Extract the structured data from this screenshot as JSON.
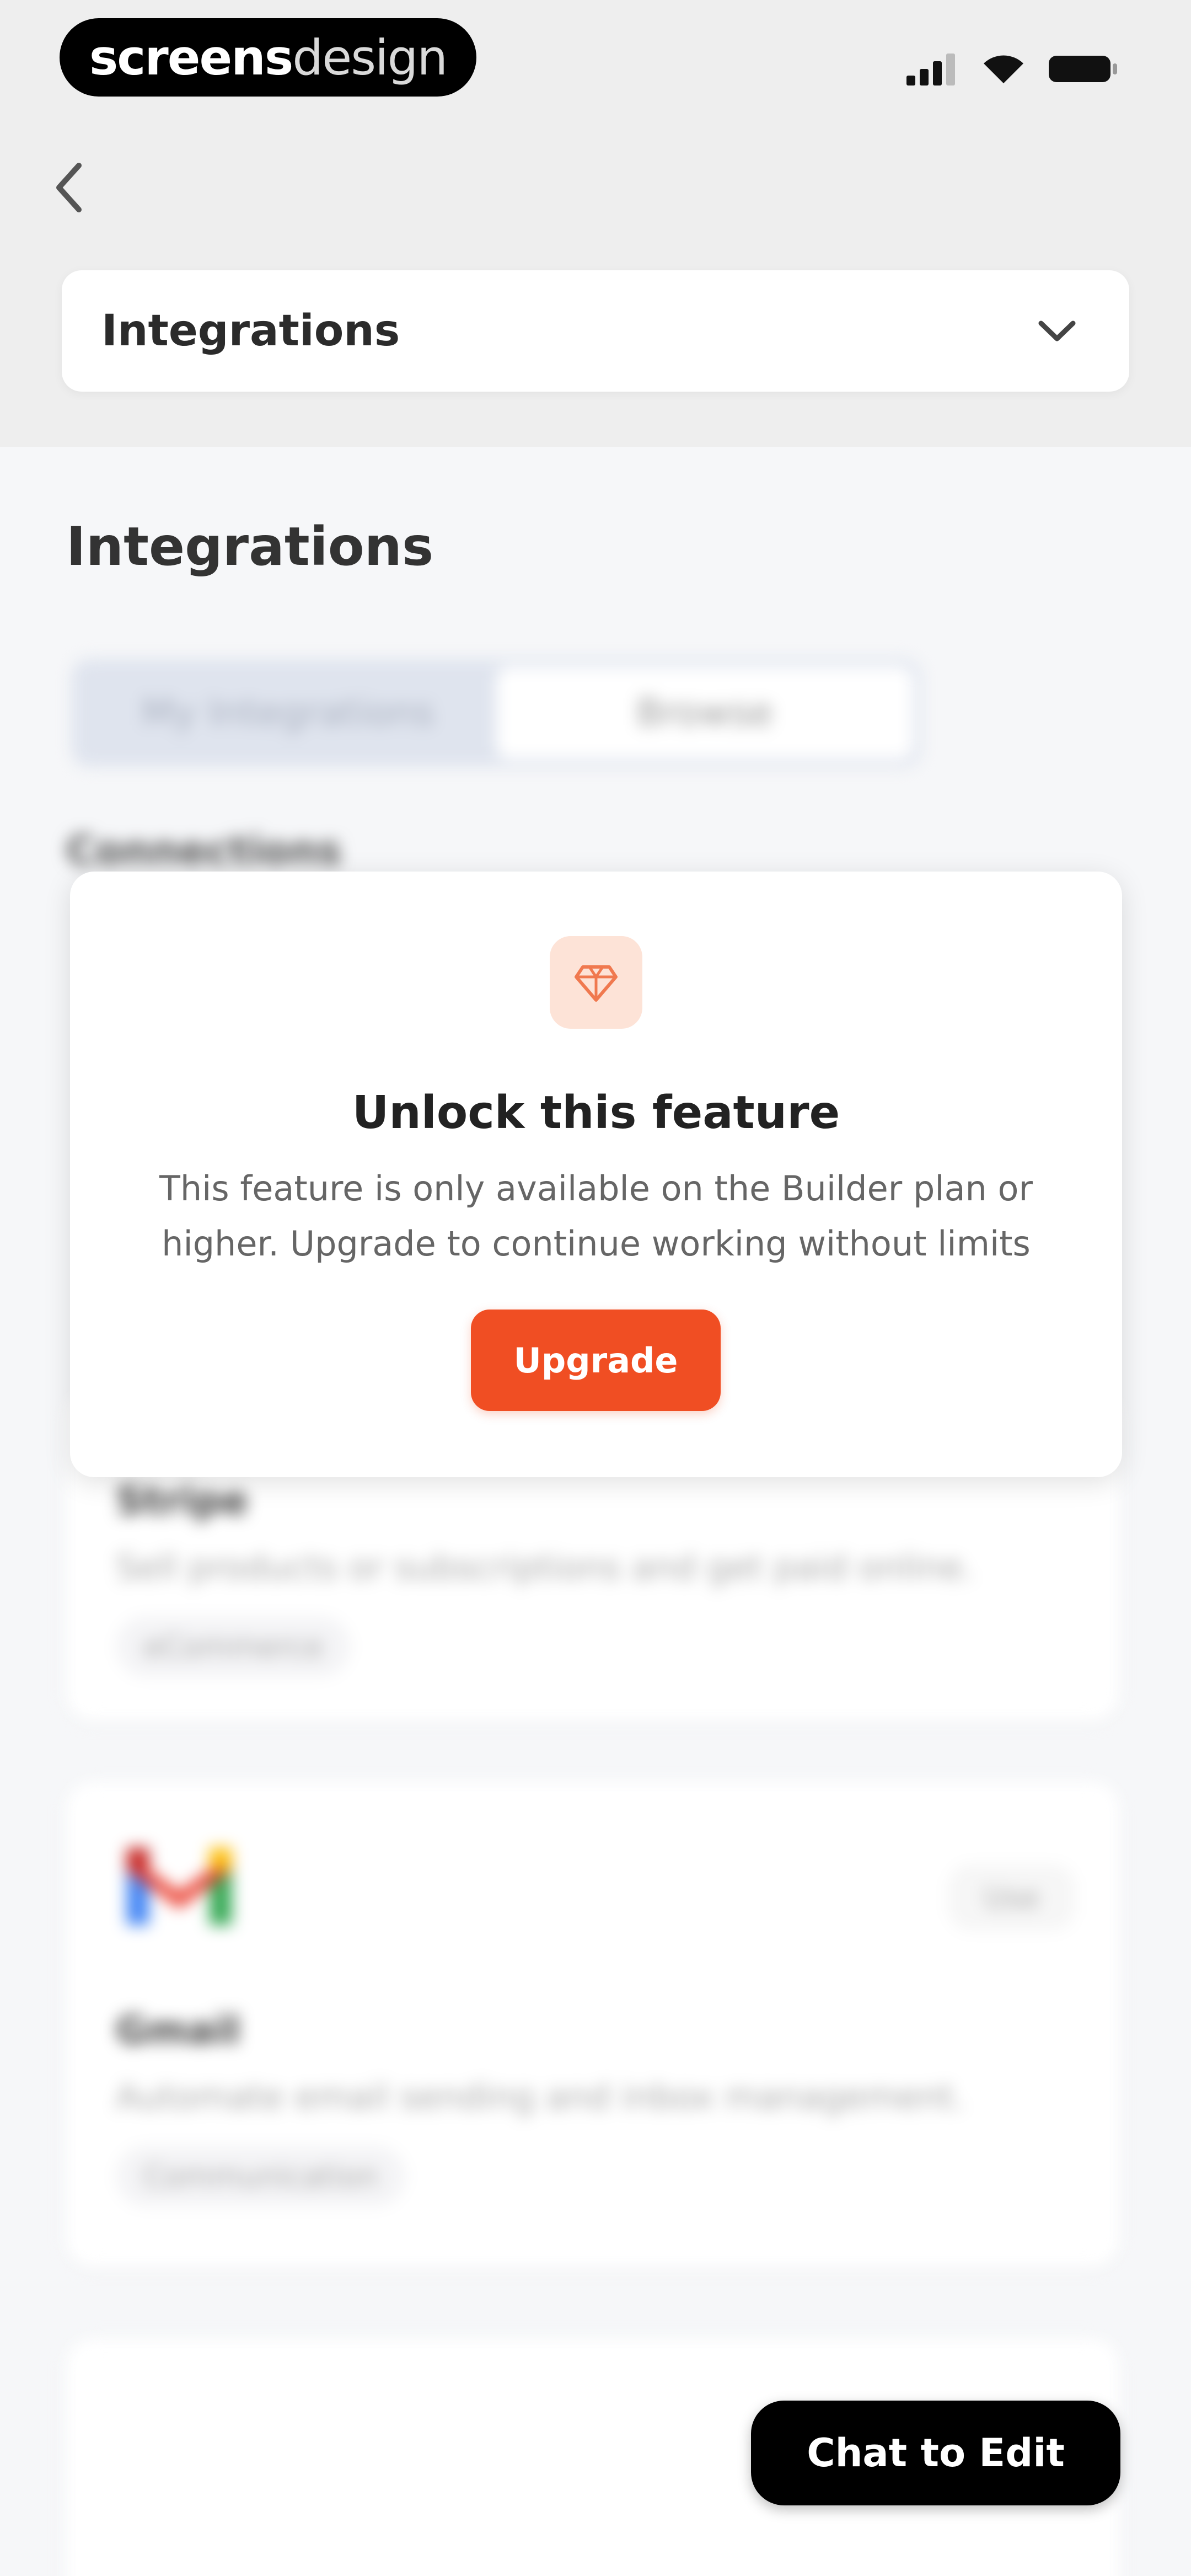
{
  "status_bar": {
    "brand_bold": "screens",
    "brand_light": "design",
    "icons": [
      "signal-icon",
      "wifi-icon",
      "battery-icon"
    ]
  },
  "header": {
    "back_icon": "chevron-left-icon",
    "section_selector": {
      "value": "Integrations",
      "icon": "chevron-down-icon"
    }
  },
  "main": {
    "title": "Integrations",
    "tabs": [
      {
        "label": "My Integrations",
        "active": false
      },
      {
        "label": "Browse",
        "active": true
      }
    ],
    "section_label": "Connections",
    "integrations": [
      {
        "name": "Stripe",
        "description": "Sell products or subscriptions and get paid online.",
        "tag": "eCommerce"
      },
      {
        "name": "Gmail",
        "description": "Automate email sending and inbox management.",
        "tag": "Communication",
        "action_label": "Use"
      }
    ]
  },
  "modal": {
    "icon": "diamond-icon",
    "title": "Unlock this feature",
    "body": "This feature is only available on the Builder plan or higher. Upgrade to continue working without limits",
    "cta_label": "Upgrade"
  },
  "floating": {
    "chat_label": "Chat to Edit"
  },
  "colors": {
    "accent": "#f04e23",
    "accent_soft": "#fde3d7",
    "background": "#f6f7f9",
    "header_background": "#eeeeee"
  }
}
